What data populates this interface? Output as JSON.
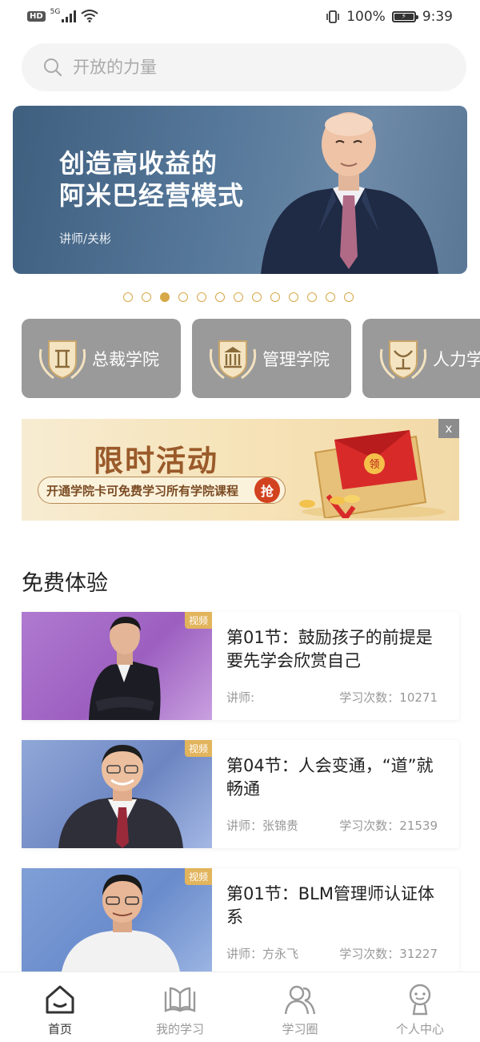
{
  "status_bar": {
    "hd": "HD",
    "network": "5G",
    "battery": "100%",
    "battery_level": 1.0,
    "time": "9:39"
  },
  "search": {
    "placeholder": "开放的力量",
    "icon": "search-icon"
  },
  "banner": {
    "title_line1": "创造高收益的",
    "title_line2": "阿米巴经营模式",
    "lecturer": "讲师/关彬"
  },
  "carousel": {
    "total": 13,
    "active_index": 2
  },
  "categories": [
    {
      "label": "总裁学院",
      "icon": "president-emblem-icon"
    },
    {
      "label": "管理学院",
      "icon": "management-emblem-icon"
    },
    {
      "label": "人力学",
      "icon": "hr-emblem-icon"
    }
  ],
  "promo": {
    "title": "限时活动",
    "subtitle": "开通学院卡可免费学习所有学院课程",
    "grab": "抢",
    "badge": "领",
    "close": "x"
  },
  "section_title": "免费体验",
  "courses": [
    {
      "tag": "视频",
      "title": "第01节：鼓励孩子的前提是要先学会欣赏自己",
      "lecturer": "讲师:",
      "count": "学习次数：10271"
    },
    {
      "tag": "视频",
      "title": "第04节：人会变通，“道”就畅通",
      "lecturer": "讲师：张锦贵",
      "count": "学习次数：21539"
    },
    {
      "tag": "视频",
      "title": "第01节：BLM管理师认证体系",
      "lecturer": "讲师：方永飞",
      "count": "学习次数：31227"
    }
  ],
  "tabs": [
    {
      "label": "首页",
      "icon": "home-icon",
      "active": true
    },
    {
      "label": "我的学习",
      "icon": "book-icon",
      "active": false
    },
    {
      "label": "学习圈",
      "icon": "community-icon",
      "active": false
    },
    {
      "label": "个人中心",
      "icon": "profile-icon",
      "active": false
    }
  ],
  "colors": {
    "accent_gold": "#d7a847",
    "banner_blue": "#56789a",
    "category_gray": "#9a9a9a",
    "promo_brown": "#9a5a2a"
  }
}
